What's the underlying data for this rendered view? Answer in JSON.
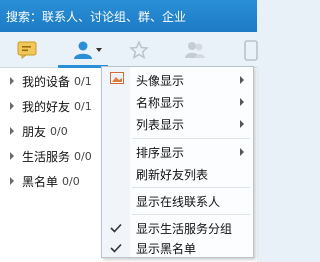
{
  "search": {
    "placeholder": "搜索：联系人、讨论组、群、企业"
  },
  "toolbar": {
    "icons": [
      "message-icon",
      "contacts-icon",
      "favorites-icon",
      "group-icon",
      "phone-icon"
    ]
  },
  "groups": [
    {
      "name": "我的设备",
      "count": "0/1"
    },
    {
      "name": "我的好友",
      "count": "0/1"
    },
    {
      "name": "朋友",
      "count": "0/0"
    },
    {
      "name": "生活服务",
      "count": "0/0"
    },
    {
      "name": "黑名单",
      "count": "0/0"
    }
  ],
  "menu": {
    "items": [
      {
        "label": "头像显示",
        "submenu": true,
        "checked": false
      },
      {
        "label": "名称显示",
        "submenu": true,
        "checked": false
      },
      {
        "label": "列表显示",
        "submenu": true,
        "checked": false
      },
      {
        "label": "排序显示",
        "submenu": true,
        "checked": false
      },
      {
        "label": "刷新好友列表",
        "submenu": false,
        "checked": false
      },
      {
        "label": "显示在线联系人",
        "submenu": false,
        "checked": false
      },
      {
        "label": "显示生活服务分组",
        "submenu": false,
        "checked": true
      },
      {
        "label": "显示黑名单",
        "submenu": false,
        "checked": true
      }
    ]
  },
  "colors": {
    "accent": "#2a8fd6",
    "toolbar_bg": "#eaf2f9",
    "menu_bg": "#fbfdff"
  }
}
